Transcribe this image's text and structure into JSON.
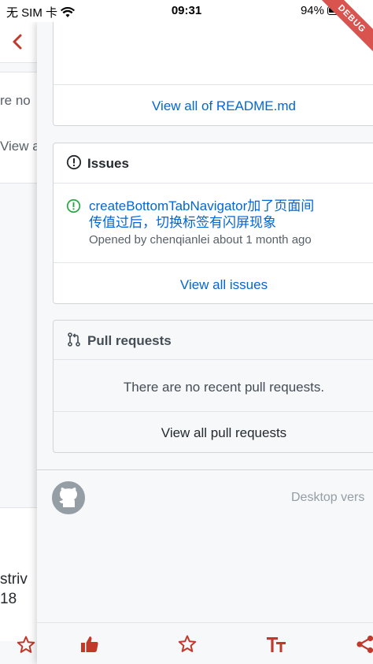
{
  "status_bar": {
    "carrier": "无 SIM 卡",
    "time": "09:31",
    "battery": "94%",
    "debug_label": "DEBUG"
  },
  "background_page": {
    "text_1": "re no",
    "text_2": "View a",
    "text_3": "striv",
    "text_4": "18"
  },
  "readme": {
    "link": "View all of README.md"
  },
  "issues": {
    "title": "Issues",
    "item": {
      "title": "createBottomTabNavigator加了页面间传值过后，切换标签有闪屏现象",
      "meta": "Opened by chenqianlei about 1 month ago",
      "number": "#"
    },
    "link": "View all issues"
  },
  "pull_requests": {
    "title": "Pull requests",
    "empty": "There are no recent pull requests.",
    "link": "View all pull requests"
  },
  "footer": {
    "desktop": "Desktop vers"
  },
  "colors": {
    "accent_red": "#c0392b",
    "link_blue": "#0366d6",
    "issue_open_green": "#28a745"
  },
  "icons": {
    "back": "chevron-left-icon",
    "issues": "info-circle-icon",
    "issue_open": "issue-opened-icon",
    "pull_request": "git-pull-request-icon",
    "github": "github-mark-icon",
    "like": "thumbs-up-icon",
    "star": "star-icon",
    "font": "font-size-icon",
    "share": "share-icon"
  }
}
